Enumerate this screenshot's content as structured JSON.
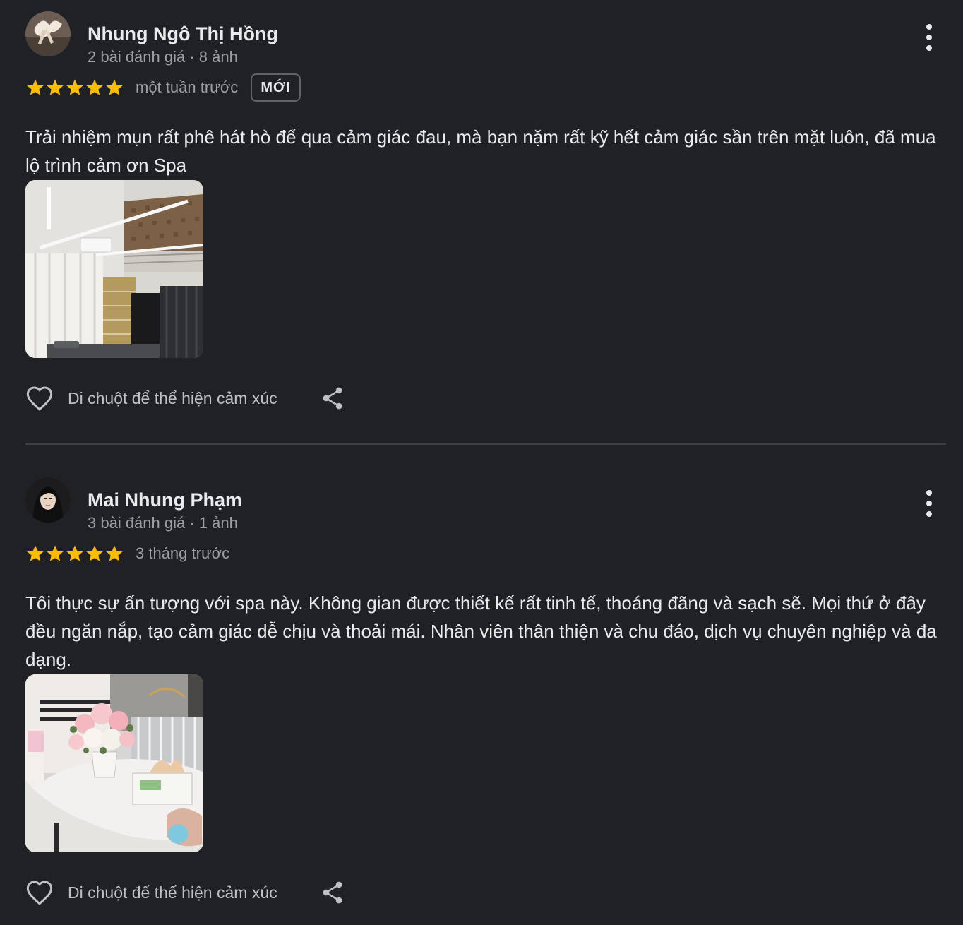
{
  "colors": {
    "background": "#202124",
    "star": "#fbbc04",
    "text_primary": "#e8eaed",
    "text_secondary": "#9aa0a6",
    "divider": "#3c4043"
  },
  "reviews": [
    {
      "author_name": "Nhung Ngô Thị Hồng",
      "author_meta": "2 bài đánh giá · 8 ảnh",
      "rating": 5,
      "date": "một tuần trước",
      "badge": "MỚI",
      "text": "Trải nhiệm mụn rất phê hát hò để qua cảm giác đau, mà bạn nặm rất kỹ hết cảm giác sần trên mặt luôn, đã mua lộ trình cảm ơn Spa",
      "photo_icon": "spa-room-photo",
      "react_label": "Di chuột để thể hiện cảm xúc",
      "icons": [
        "more-vert-icon",
        "star-icon",
        "heart-icon",
        "share-icon"
      ]
    },
    {
      "author_name": "Mai Nhung Phạm",
      "author_meta": "3 bài đánh giá · 1 ảnh",
      "rating": 5,
      "date": "3 tháng trước",
      "badge": "",
      "text": "Tôi thực sự ấn tượng với spa này. Không gian được thiết kế rất tinh tế, thoáng đãng và sạch sẽ. Mọi thứ ở đây đều ngăn nắp, tạo cảm giác dễ chịu và thoải mái. Nhân viên thân thiện và chu đáo, dịch vụ chuyên nghiệp và đa dạng.",
      "photo_icon": "flower-table-photo",
      "react_label": "Di chuột để thể hiện cảm xúc",
      "icons": [
        "more-vert-icon",
        "star-icon",
        "heart-icon",
        "share-icon"
      ]
    }
  ]
}
